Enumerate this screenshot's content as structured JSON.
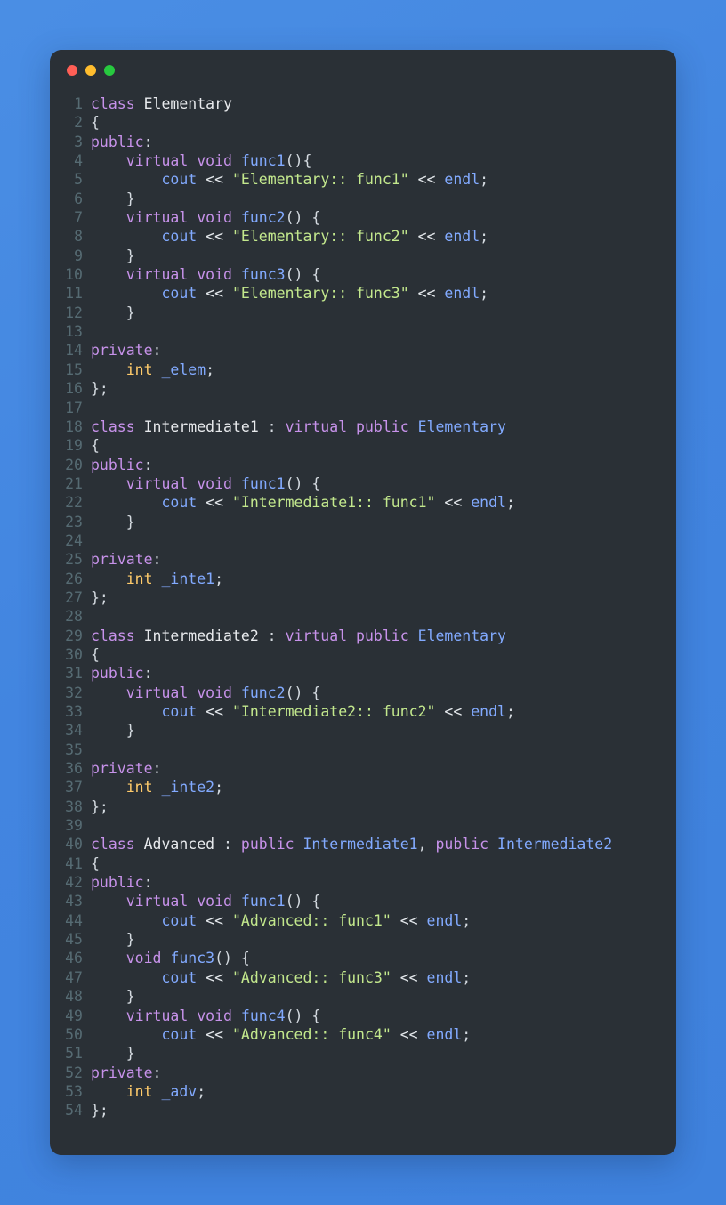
{
  "window": {
    "title": "",
    "background_color": "#4285e0",
    "panel_color": "#2a3036",
    "traffic_lights": [
      {
        "name": "close",
        "color": "#ff5f56"
      },
      {
        "name": "minimize",
        "color": "#ffbd2e"
      },
      {
        "name": "maximize",
        "color": "#27c93f"
      }
    ]
  },
  "editor": {
    "language": "cpp",
    "gutter_color": "#566b73",
    "colors": {
      "keyword": "#c792ea",
      "type": "#ffcb6b",
      "class_name": "#e8eaed",
      "identifier": "#82aaff",
      "string": "#c3e88d",
      "punctuation": "#d4dae0"
    },
    "line_count": 54,
    "lines": [
      {
        "n": "1",
        "tokens": [
          [
            "kw",
            "class"
          ],
          [
            "pun",
            " "
          ],
          [
            "cls",
            "Elementary"
          ]
        ]
      },
      {
        "n": "2",
        "tokens": [
          [
            "pun",
            "{"
          ]
        ]
      },
      {
        "n": "3",
        "tokens": [
          [
            "kw",
            "public"
          ],
          [
            "pun",
            ":"
          ]
        ]
      },
      {
        "n": "4",
        "tokens": [
          [
            "pun",
            "    "
          ],
          [
            "kw",
            "virtual"
          ],
          [
            "pun",
            " "
          ],
          [
            "kw",
            "void"
          ],
          [
            "pun",
            " "
          ],
          [
            "ref",
            "func1"
          ],
          [
            "pun",
            "(){"
          ]
        ]
      },
      {
        "n": "5",
        "tokens": [
          [
            "pun",
            "        "
          ],
          [
            "ref",
            "cout"
          ],
          [
            "pun",
            " "
          ],
          [
            "op",
            "<<"
          ],
          [
            "pun",
            " "
          ],
          [
            "str",
            "\"Elementary:: func1\""
          ],
          [
            "pun",
            " "
          ],
          [
            "op",
            "<<"
          ],
          [
            "pun",
            " "
          ],
          [
            "ref",
            "endl"
          ],
          [
            "pun",
            ";"
          ]
        ]
      },
      {
        "n": "6",
        "tokens": [
          [
            "pun",
            "    }"
          ]
        ]
      },
      {
        "n": "7",
        "tokens": [
          [
            "pun",
            "    "
          ],
          [
            "kw",
            "virtual"
          ],
          [
            "pun",
            " "
          ],
          [
            "kw",
            "void"
          ],
          [
            "pun",
            " "
          ],
          [
            "ref",
            "func2"
          ],
          [
            "pun",
            "() {"
          ]
        ]
      },
      {
        "n": "8",
        "tokens": [
          [
            "pun",
            "        "
          ],
          [
            "ref",
            "cout"
          ],
          [
            "pun",
            " "
          ],
          [
            "op",
            "<<"
          ],
          [
            "pun",
            " "
          ],
          [
            "str",
            "\"Elementary:: func2\""
          ],
          [
            "pun",
            " "
          ],
          [
            "op",
            "<<"
          ],
          [
            "pun",
            " "
          ],
          [
            "ref",
            "endl"
          ],
          [
            "pun",
            ";"
          ]
        ]
      },
      {
        "n": "9",
        "tokens": [
          [
            "pun",
            "    }"
          ]
        ]
      },
      {
        "n": "10",
        "tokens": [
          [
            "pun",
            "    "
          ],
          [
            "kw",
            "virtual"
          ],
          [
            "pun",
            " "
          ],
          [
            "kw",
            "void"
          ],
          [
            "pun",
            " "
          ],
          [
            "ref",
            "func3"
          ],
          [
            "pun",
            "() {"
          ]
        ]
      },
      {
        "n": "11",
        "tokens": [
          [
            "pun",
            "        "
          ],
          [
            "ref",
            "cout"
          ],
          [
            "pun",
            " "
          ],
          [
            "op",
            "<<"
          ],
          [
            "pun",
            " "
          ],
          [
            "str",
            "\"Elementary:: func3\""
          ],
          [
            "pun",
            " "
          ],
          [
            "op",
            "<<"
          ],
          [
            "pun",
            " "
          ],
          [
            "ref",
            "endl"
          ],
          [
            "pun",
            ";"
          ]
        ]
      },
      {
        "n": "12",
        "tokens": [
          [
            "pun",
            "    }"
          ]
        ]
      },
      {
        "n": "13",
        "tokens": []
      },
      {
        "n": "14",
        "tokens": [
          [
            "kw",
            "private"
          ],
          [
            "pun",
            ":"
          ]
        ]
      },
      {
        "n": "15",
        "tokens": [
          [
            "pun",
            "    "
          ],
          [
            "type",
            "int"
          ],
          [
            "pun",
            " "
          ],
          [
            "ref",
            "_elem"
          ],
          [
            "pun",
            ";"
          ]
        ]
      },
      {
        "n": "16",
        "tokens": [
          [
            "pun",
            "};"
          ]
        ]
      },
      {
        "n": "17",
        "tokens": []
      },
      {
        "n": "18",
        "tokens": [
          [
            "kw",
            "class"
          ],
          [
            "pun",
            " "
          ],
          [
            "cls",
            "Intermediate1"
          ],
          [
            "pun",
            " : "
          ],
          [
            "kw",
            "virtual"
          ],
          [
            "pun",
            " "
          ],
          [
            "kw",
            "public"
          ],
          [
            "pun",
            " "
          ],
          [
            "ref",
            "Elementary"
          ]
        ]
      },
      {
        "n": "19",
        "tokens": [
          [
            "pun",
            "{"
          ]
        ]
      },
      {
        "n": "20",
        "tokens": [
          [
            "kw",
            "public"
          ],
          [
            "pun",
            ":"
          ]
        ]
      },
      {
        "n": "21",
        "tokens": [
          [
            "pun",
            "    "
          ],
          [
            "kw",
            "virtual"
          ],
          [
            "pun",
            " "
          ],
          [
            "kw",
            "void"
          ],
          [
            "pun",
            " "
          ],
          [
            "ref",
            "func1"
          ],
          [
            "pun",
            "() {"
          ]
        ]
      },
      {
        "n": "22",
        "tokens": [
          [
            "pun",
            "        "
          ],
          [
            "ref",
            "cout"
          ],
          [
            "pun",
            " "
          ],
          [
            "op",
            "<<"
          ],
          [
            "pun",
            " "
          ],
          [
            "str",
            "\"Intermediate1:: func1\""
          ],
          [
            "pun",
            " "
          ],
          [
            "op",
            "<<"
          ],
          [
            "pun",
            " "
          ],
          [
            "ref",
            "endl"
          ],
          [
            "pun",
            ";"
          ]
        ]
      },
      {
        "n": "23",
        "tokens": [
          [
            "pun",
            "    }"
          ]
        ]
      },
      {
        "n": "24",
        "tokens": []
      },
      {
        "n": "25",
        "tokens": [
          [
            "kw",
            "private"
          ],
          [
            "pun",
            ":"
          ]
        ]
      },
      {
        "n": "26",
        "tokens": [
          [
            "pun",
            "    "
          ],
          [
            "type",
            "int"
          ],
          [
            "pun",
            " "
          ],
          [
            "ref",
            "_inte1"
          ],
          [
            "pun",
            ";"
          ]
        ]
      },
      {
        "n": "27",
        "tokens": [
          [
            "pun",
            "};"
          ]
        ]
      },
      {
        "n": "28",
        "tokens": []
      },
      {
        "n": "29",
        "tokens": [
          [
            "kw",
            "class"
          ],
          [
            "pun",
            " "
          ],
          [
            "cls",
            "Intermediate2"
          ],
          [
            "pun",
            " : "
          ],
          [
            "kw",
            "virtual"
          ],
          [
            "pun",
            " "
          ],
          [
            "kw",
            "public"
          ],
          [
            "pun",
            " "
          ],
          [
            "ref",
            "Elementary"
          ]
        ]
      },
      {
        "n": "30",
        "tokens": [
          [
            "pun",
            "{"
          ]
        ]
      },
      {
        "n": "31",
        "tokens": [
          [
            "kw",
            "public"
          ],
          [
            "pun",
            ":"
          ]
        ]
      },
      {
        "n": "32",
        "tokens": [
          [
            "pun",
            "    "
          ],
          [
            "kw",
            "virtual"
          ],
          [
            "pun",
            " "
          ],
          [
            "kw",
            "void"
          ],
          [
            "pun",
            " "
          ],
          [
            "ref",
            "func2"
          ],
          [
            "pun",
            "() {"
          ]
        ]
      },
      {
        "n": "33",
        "tokens": [
          [
            "pun",
            "        "
          ],
          [
            "ref",
            "cout"
          ],
          [
            "pun",
            " "
          ],
          [
            "op",
            "<<"
          ],
          [
            "pun",
            " "
          ],
          [
            "str",
            "\"Intermediate2:: func2\""
          ],
          [
            "pun",
            " "
          ],
          [
            "op",
            "<<"
          ],
          [
            "pun",
            " "
          ],
          [
            "ref",
            "endl"
          ],
          [
            "pun",
            ";"
          ]
        ]
      },
      {
        "n": "34",
        "tokens": [
          [
            "pun",
            "    }"
          ]
        ]
      },
      {
        "n": "35",
        "tokens": []
      },
      {
        "n": "36",
        "tokens": [
          [
            "kw",
            "private"
          ],
          [
            "pun",
            ":"
          ]
        ]
      },
      {
        "n": "37",
        "tokens": [
          [
            "pun",
            "    "
          ],
          [
            "type",
            "int"
          ],
          [
            "pun",
            " "
          ],
          [
            "ref",
            "_inte2"
          ],
          [
            "pun",
            ";"
          ]
        ]
      },
      {
        "n": "38",
        "tokens": [
          [
            "pun",
            "};"
          ]
        ]
      },
      {
        "n": "39",
        "tokens": []
      },
      {
        "n": "40",
        "tokens": [
          [
            "kw",
            "class"
          ],
          [
            "pun",
            " "
          ],
          [
            "cls",
            "Advanced"
          ],
          [
            "pun",
            " : "
          ],
          [
            "kw",
            "public"
          ],
          [
            "pun",
            " "
          ],
          [
            "ref",
            "Intermediate1"
          ],
          [
            "pun",
            ", "
          ],
          [
            "kw",
            "public"
          ],
          [
            "pun",
            " "
          ],
          [
            "ref",
            "Intermediate2"
          ]
        ]
      },
      {
        "n": "41",
        "tokens": [
          [
            "pun",
            "{"
          ]
        ]
      },
      {
        "n": "42",
        "tokens": [
          [
            "kw",
            "public"
          ],
          [
            "pun",
            ":"
          ]
        ]
      },
      {
        "n": "43",
        "tokens": [
          [
            "pun",
            "    "
          ],
          [
            "kw",
            "virtual"
          ],
          [
            "pun",
            " "
          ],
          [
            "kw",
            "void"
          ],
          [
            "pun",
            " "
          ],
          [
            "ref",
            "func1"
          ],
          [
            "pun",
            "() {"
          ]
        ]
      },
      {
        "n": "44",
        "tokens": [
          [
            "pun",
            "        "
          ],
          [
            "ref",
            "cout"
          ],
          [
            "pun",
            " "
          ],
          [
            "op",
            "<<"
          ],
          [
            "pun",
            " "
          ],
          [
            "str",
            "\"Advanced:: func1\""
          ],
          [
            "pun",
            " "
          ],
          [
            "op",
            "<<"
          ],
          [
            "pun",
            " "
          ],
          [
            "ref",
            "endl"
          ],
          [
            "pun",
            ";"
          ]
        ]
      },
      {
        "n": "45",
        "tokens": [
          [
            "pun",
            "    }"
          ]
        ]
      },
      {
        "n": "46",
        "tokens": [
          [
            "pun",
            "    "
          ],
          [
            "kw",
            "void"
          ],
          [
            "pun",
            " "
          ],
          [
            "ref",
            "func3"
          ],
          [
            "pun",
            "() {"
          ]
        ]
      },
      {
        "n": "47",
        "tokens": [
          [
            "pun",
            "        "
          ],
          [
            "ref",
            "cout"
          ],
          [
            "pun",
            " "
          ],
          [
            "op",
            "<<"
          ],
          [
            "pun",
            " "
          ],
          [
            "str",
            "\"Advanced:: func3\""
          ],
          [
            "pun",
            " "
          ],
          [
            "op",
            "<<"
          ],
          [
            "pun",
            " "
          ],
          [
            "ref",
            "endl"
          ],
          [
            "pun",
            ";"
          ]
        ]
      },
      {
        "n": "48",
        "tokens": [
          [
            "pun",
            "    }"
          ]
        ]
      },
      {
        "n": "49",
        "tokens": [
          [
            "pun",
            "    "
          ],
          [
            "kw",
            "virtual"
          ],
          [
            "pun",
            " "
          ],
          [
            "kw",
            "void"
          ],
          [
            "pun",
            " "
          ],
          [
            "ref",
            "func4"
          ],
          [
            "pun",
            "() {"
          ]
        ]
      },
      {
        "n": "50",
        "tokens": [
          [
            "pun",
            "        "
          ],
          [
            "ref",
            "cout"
          ],
          [
            "pun",
            " "
          ],
          [
            "op",
            "<<"
          ],
          [
            "pun",
            " "
          ],
          [
            "str",
            "\"Advanced:: func4\""
          ],
          [
            "pun",
            " "
          ],
          [
            "op",
            "<<"
          ],
          [
            "pun",
            " "
          ],
          [
            "ref",
            "endl"
          ],
          [
            "pun",
            ";"
          ]
        ]
      },
      {
        "n": "51",
        "tokens": [
          [
            "pun",
            "    }"
          ]
        ]
      },
      {
        "n": "52",
        "tokens": [
          [
            "kw",
            "private"
          ],
          [
            "pun",
            ":"
          ]
        ]
      },
      {
        "n": "53",
        "tokens": [
          [
            "pun",
            "    "
          ],
          [
            "type",
            "int"
          ],
          [
            "pun",
            " "
          ],
          [
            "ref",
            "_adv"
          ],
          [
            "pun",
            ";"
          ]
        ]
      },
      {
        "n": "54",
        "tokens": [
          [
            "pun",
            "};"
          ]
        ]
      }
    ]
  }
}
